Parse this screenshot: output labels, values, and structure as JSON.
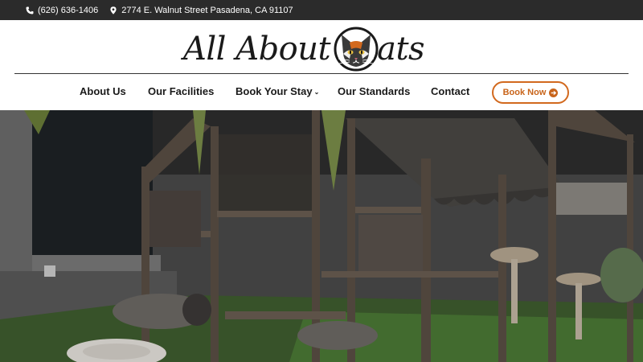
{
  "topbar": {
    "phone": "(626) 636-1406",
    "phone_icon": "phone-icon",
    "address": "2774 E. Walnut Street Pasadena, CA 91107",
    "address_icon": "map-marker-icon",
    "background": "#2b2b2b"
  },
  "logo": {
    "text_left": "All About",
    "text_right": "ats",
    "icon": "cat-head-icon"
  },
  "nav": {
    "items": [
      {
        "label": "About Us"
      },
      {
        "label": "Our Facilities"
      },
      {
        "label": "Book Your Stay",
        "dropdown": true
      },
      {
        "label": "Our Standards"
      },
      {
        "label": "Contact"
      }
    ],
    "book_button": "Book Now",
    "accent": "#c8641a"
  },
  "hero": {
    "image": "cat-enclosures-photo"
  }
}
